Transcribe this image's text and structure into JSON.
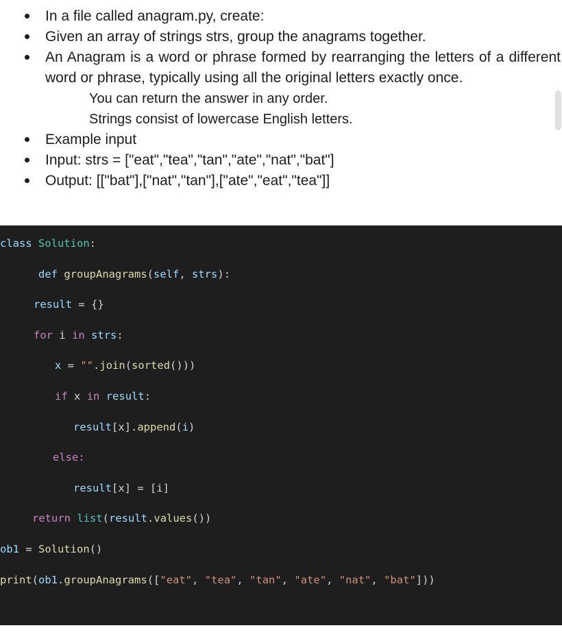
{
  "document": {
    "bullets": [
      {
        "marker": "dot",
        "level": 1,
        "text": "In a file called anagram.py, create:"
      },
      {
        "marker": "dot",
        "level": 1,
        "text": "Given an array of strings strs, group the anagrams together."
      },
      {
        "marker": "dot",
        "level": 1,
        "text": "An Anagram is a word or phrase formed by rearranging the letters of a different word or phrase, typically using all the original letters exactly once."
      },
      {
        "marker": "ring",
        "level": 2,
        "text": "You can return the answer in any order."
      },
      {
        "marker": "ring",
        "level": 2,
        "text": "Strings consist of lowercase English letters."
      },
      {
        "marker": "dot",
        "level": 1,
        "text": "Example input"
      },
      {
        "marker": "dot",
        "level": 1,
        "text": "Input: strs = [\"eat\",\"tea\",\"tan\",\"ate\",\"nat\",\"bat\"]"
      },
      {
        "marker": "dot",
        "level": 1,
        "text": "Output: [[\"bat\"],[\"nat\",\"tan\"],[\"ate\",\"eat\",\"tea\"]]"
      }
    ]
  },
  "code": {
    "language": "python",
    "background": "#1e1e1e",
    "plain_text": "class Solution:\n\n    def groupAnagrams(self, strs):\n\n  result = {}\n\n  for i in strs:\n\n    x = \"\".join(sorted())\n\n    if x in result:\n\n      result[x].append(i)\n\n    else:\n\n      result[x] = [i]\n\n  return list(result.values())\n\nob1 = Solution()\n\nprint(ob1.groupAnagrams([\"eat\", \"tea\", \"tan\", \"ate\", \"nat\", \"bat\"]))",
    "lines": [
      {
        "id": "l1",
        "indent": 0,
        "text": "class Solution:"
      },
      {
        "id": "l2",
        "indent": 56,
        "text": "def groupAnagrams(self, strs):"
      },
      {
        "id": "l3",
        "indent": 49,
        "text": "result = {}"
      },
      {
        "id": "l4",
        "indent": 49,
        "text": "for i in strs:"
      },
      {
        "id": "l5",
        "indent": 80,
        "text": "x = \"\".join(sorted())"
      },
      {
        "id": "l6",
        "indent": 80,
        "text": "if x in result:"
      },
      {
        "id": "l7",
        "indent": 107,
        "text": "result[x].append(i)"
      },
      {
        "id": "l8",
        "indent": 77,
        "text": "else:"
      },
      {
        "id": "l9",
        "indent": 107,
        "text": "result[x] = [i]"
      },
      {
        "id": "l10",
        "indent": 47,
        "text": "return list(result.values())"
      },
      {
        "id": "l11",
        "indent": 0,
        "text": "ob1 = Solution()"
      },
      {
        "id": "l12",
        "indent": 0,
        "text": "print(ob1.groupAnagrams([\"eat\", \"tea\", \"tan\", \"ate\", \"nat\", \"bat\"]))"
      }
    ],
    "tokens": {
      "kw_class": "class",
      "name_solution": "Solution",
      "kw_def": "def",
      "fn_groupanagrams": "groupAnagrams",
      "var_self": "self",
      "var_strs": "strs",
      "var_result": "result",
      "kw_for": "for",
      "var_i": "i",
      "kw_in": "in",
      "var_x": "x",
      "str_empty": "\"\"",
      "fn_join": "join",
      "fn_sorted": "sorted",
      "kw_if": "if",
      "fn_append": "append",
      "kw_else": "else:",
      "kw_return": "return",
      "fn_list": "list",
      "fn_values": "values",
      "var_ob1": "ob1",
      "fn_print": "print",
      "str_eat": "\"eat\"",
      "str_tea": "\"tea\"",
      "str_tan": "\"tan\"",
      "str_ate": "\"ate\"",
      "str_nat": "\"nat\"",
      "str_bat": "\"bat\""
    },
    "colors": {
      "keyword": "#c586c0",
      "declaration": "#9cdcfe",
      "class_name": "#4ec9b0",
      "function": "#dcdcaa",
      "variable": "#9cdcfe",
      "string": "#ce9178",
      "plain": "#d4d4d4"
    }
  },
  "punct": {
    "colon": ":",
    "open_paren": "(",
    "close_paren": ")",
    "close_paren2": "))",
    "close_paren3": ")))",
    "comma_sp": ", ",
    "eq": " = ",
    "braces": "{}",
    "open_brk": "[",
    "close_brk": "]",
    "dot": ".",
    "brk_x": "[x]",
    "brk_i": "[i]",
    "open_pb": "([",
    "close_bp": "])",
    "space": " "
  }
}
